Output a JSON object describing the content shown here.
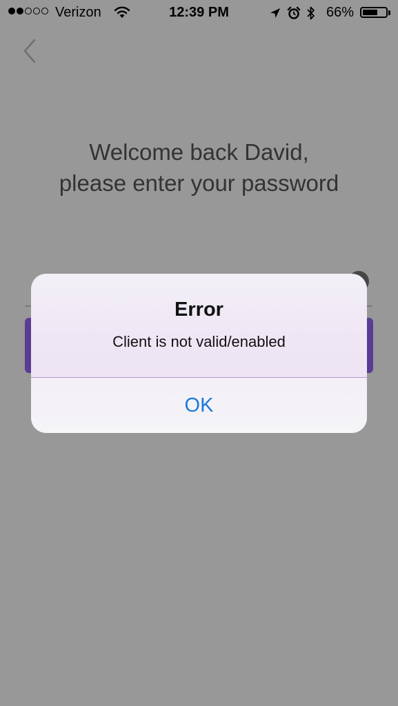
{
  "status_bar": {
    "signal_filled": 2,
    "signal_empty": 3,
    "carrier": "Verizon",
    "time": "12:39 PM",
    "battery_percent": "66%",
    "battery_level": 0.66,
    "icons": [
      "location-arrow-icon",
      "alarm-icon",
      "bluetooth-icon"
    ]
  },
  "nav": {
    "back_icon": "chevron-left-icon"
  },
  "welcome": {
    "line1": "Welcome back David,",
    "line2": "please enter your password"
  },
  "colors": {
    "dim_overlay": "#989898",
    "submit_button": "#5a3c94",
    "alert_ok": "#1a7ad8"
  },
  "alert": {
    "title": "Error",
    "message": "Client is not valid/enabled",
    "button_label": "OK"
  }
}
